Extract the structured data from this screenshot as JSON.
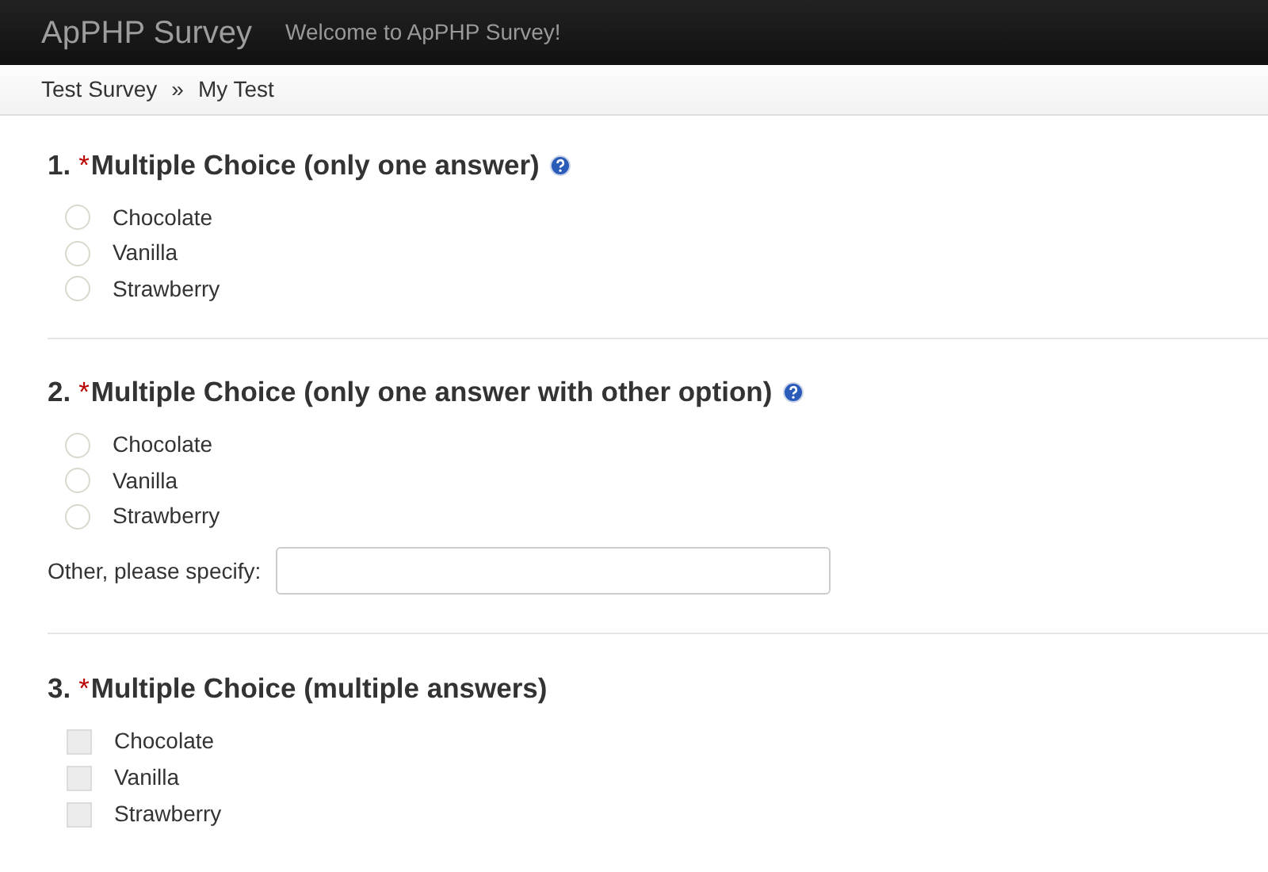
{
  "navbar": {
    "brand": "ApPHP Survey",
    "welcome": "Welcome to ApPHP Survey!"
  },
  "breadcrumb": {
    "items": [
      "Test Survey",
      "My Test"
    ],
    "separator": "»"
  },
  "questions": [
    {
      "number": "1.",
      "required_mark": "*",
      "title": "Multiple Choice (only one answer)",
      "help": true,
      "kind": "radio",
      "options": [
        {
          "label": "Chocolate",
          "selected": false
        },
        {
          "label": "Vanilla",
          "selected": false
        },
        {
          "label": "Strawberry",
          "selected": false
        }
      ]
    },
    {
      "number": "2.",
      "required_mark": "*",
      "title": "Multiple Choice (only one answer with other option)",
      "help": true,
      "kind": "radio",
      "options": [
        {
          "label": "Chocolate",
          "selected": false
        },
        {
          "label": "Vanilla",
          "selected": false
        },
        {
          "label": "Strawberry",
          "selected": false
        }
      ],
      "other": {
        "label": "Other, please specify:"
      }
    },
    {
      "number": "3.",
      "required_mark": "*",
      "title": "Multiple Choice (multiple answers)",
      "help": false,
      "kind": "checkbox",
      "options": [
        {
          "label": "Chocolate",
          "checked": false
        },
        {
          "label": "Vanilla",
          "checked": false
        },
        {
          "label": "Strawberry",
          "checked": false
        }
      ]
    }
  ]
}
